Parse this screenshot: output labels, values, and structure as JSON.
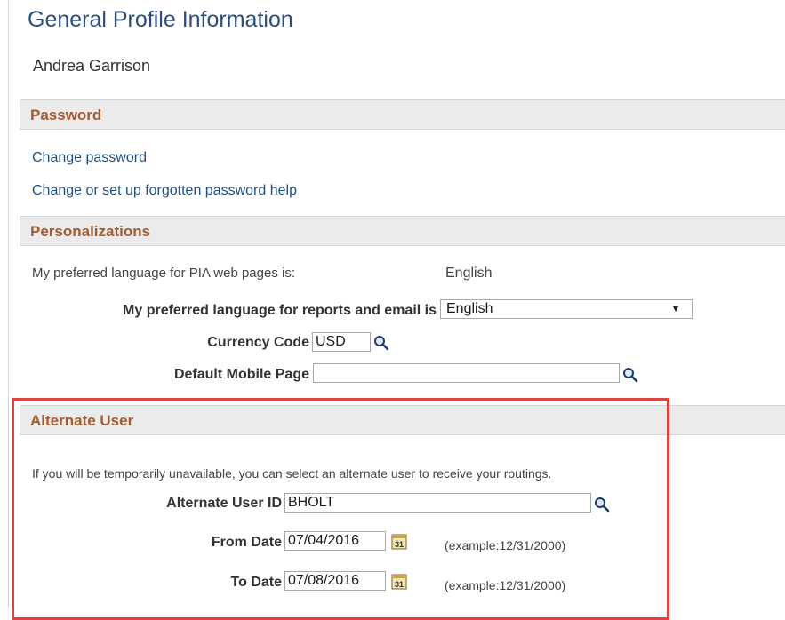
{
  "page": {
    "title": "General Profile Information",
    "user_name": "Andrea Garrison"
  },
  "password": {
    "header": "Password",
    "links": [
      "Change password",
      "Change or set up forgotten password help"
    ]
  },
  "personalizations": {
    "header": "Personalizations",
    "pia_language_label": "My preferred language for PIA web pages is:",
    "pia_language_value": "English",
    "report_language_label": "My preferred language for reports and email is",
    "report_language_value": "English",
    "currency_label": "Currency Code",
    "currency_value": "USD",
    "mobile_page_label": "Default Mobile Page",
    "mobile_page_value": ""
  },
  "alternate_user": {
    "header": "Alternate User",
    "description": "If you will be temporarily unavailable, you can select an alternate user to receive your routings.",
    "user_id_label": "Alternate User ID",
    "user_id_value": "BHOLT",
    "from_date_label": "From Date",
    "from_date_value": "07/04/2016",
    "to_date_label": "To Date",
    "to_date_value": "07/08/2016",
    "date_example": "(example:12/31/2000)"
  },
  "icons": {
    "lookup": "magnifier-lookup-icon",
    "calendar": "calendar-icon",
    "dropdown": "chevron-down-icon"
  },
  "colors": {
    "title": "#2d4e7a",
    "section_header": "#a35c31",
    "link": "#1d4f86",
    "highlight": "#e0413e"
  }
}
